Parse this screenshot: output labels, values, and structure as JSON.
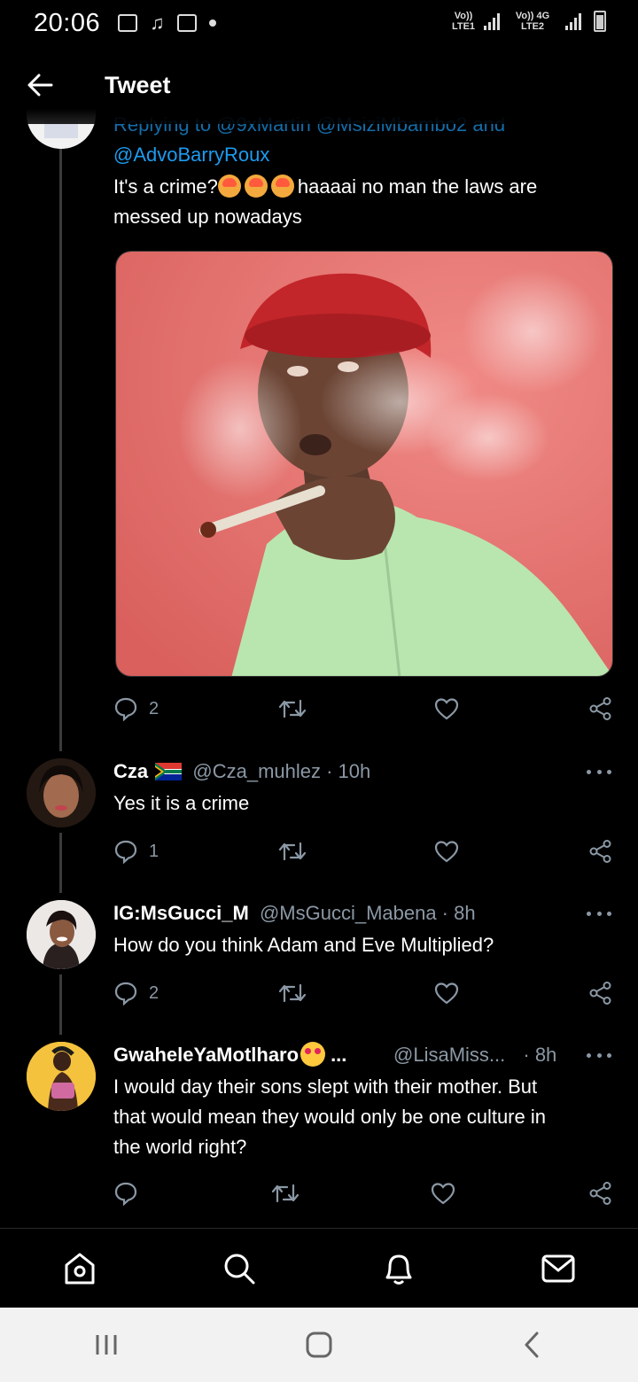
{
  "status_bar": {
    "time": "20:06",
    "sim1_label": "Vo)) LTE1",
    "sim2_label": "Vo)) 4G LTE2"
  },
  "app_bar": {
    "title": "Tweet"
  },
  "main_tweet": {
    "replying_line": "Replying to @9xMartin @MsiziMbambo2 and",
    "replying_line2": "@AdvoBarryRoux",
    "text_part1": "It's a crime?",
    "text_part2": "haaaai no man  the laws are",
    "text_line2": "messed up nowadays",
    "reply_count": "2"
  },
  "replies": [
    {
      "name": "Cza",
      "handle": "@Cza_muhlez · 10h",
      "text": "Yes it is a crime",
      "reply_count": "1"
    },
    {
      "name": "IG:MsGucci_M",
      "handle": "@MsGucci_Mabena · 8h",
      "text": "How do you think Adam and Eve Multiplied?",
      "reply_count": "2"
    },
    {
      "name": "GwaheleYaMotlharo",
      "name_suffix": "...",
      "handle": "@LisaMiss...",
      "time": "· 8h",
      "text_line1": "I would day their sons slept with their mother. But",
      "text_line2": "that would mean they would only be one culture in",
      "text_line3": "the world right?"
    }
  ],
  "icons": {
    "back": "arrow-left-icon",
    "reply": "comment-icon",
    "retweet": "retweet-icon",
    "like": "heart-icon",
    "share": "share-icon",
    "more": "more-icon",
    "home": "home-icon",
    "search": "search-icon",
    "notifications": "bell-icon",
    "messages": "mail-icon"
  },
  "colors": {
    "link": "#1d9bf0",
    "muted": "#8b98a5",
    "background": "#000000"
  }
}
